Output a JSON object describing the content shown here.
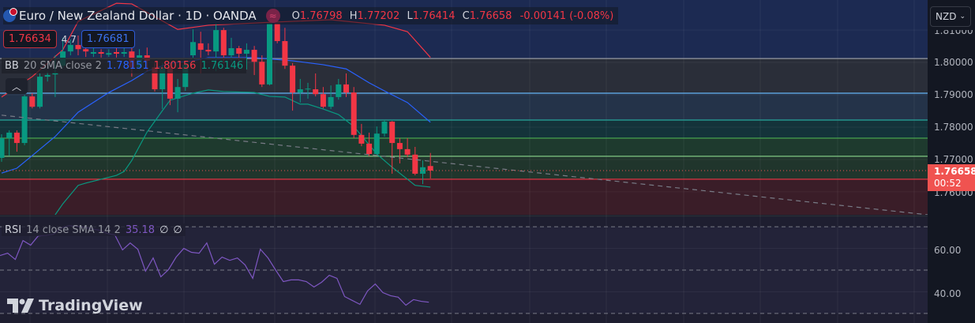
{
  "header": {
    "symbol": "Euro / New Zealand Dollar · 1D · OANDA",
    "o_label": "O",
    "o": "1.76798",
    "h_label": "H",
    "h": "1.77202",
    "l_label": "L",
    "l": "1.76414",
    "c_label": "C",
    "c": "1.76658",
    "change": "-0.00141 (-0.08%)",
    "flag_icon": "eu-nz-flag-icon",
    "badge_icon": "data-stream-icon"
  },
  "quote": {
    "bid": "1.76634",
    "spread": "4.7",
    "ask": "1.76681"
  },
  "bb_legend": {
    "name": "BB",
    "params": "20 SMA close 2",
    "basis": "1.78151",
    "upper": "1.80156",
    "lower": "1.76146"
  },
  "rsi_legend": {
    "name": "RSI",
    "params": "14 close SMA 14 2",
    "value": "35.18",
    "na1": "∅",
    "na2": "∅"
  },
  "price_axis": {
    "currency": "NZD",
    "ticks": [
      "1.81000",
      "1.80000",
      "1.79000",
      "1.78000",
      "1.77000",
      "1.76000"
    ],
    "last_price": "1.76658",
    "countdown": "00:52"
  },
  "rsi_axis": {
    "ticks": [
      "60.00",
      "40.00"
    ]
  },
  "branding": "TradingView",
  "colors": {
    "up": "#089981",
    "down": "#f23645",
    "bb_basis": "#2962ff",
    "bb_upper": "#f23645",
    "bb_lower": "#089981",
    "rsi": "#7e57c2"
  },
  "chart_data": {
    "type": "candlestick",
    "ylim": [
      1.7529,
      1.8193
    ],
    "rsi_ylim": [
      25.6,
      74.4
    ],
    "candles": [
      [
        1.7705,
        1.7778,
        1.7693,
        1.7766
      ],
      [
        1.7766,
        1.779,
        1.7712,
        1.7783
      ],
      [
        1.7783,
        1.779,
        1.7724,
        1.7751
      ],
      [
        1.7751,
        1.79,
        1.7744,
        1.7895
      ],
      [
        1.7895,
        1.7905,
        1.7858,
        1.7863
      ],
      [
        1.7863,
        1.7966,
        1.7858,
        1.7956
      ],
      [
        1.7956,
        1.7971,
        1.7941,
        1.7961
      ],
      [
        1.7963,
        1.8022,
        1.7893,
        1.7968
      ],
      [
        1.799,
        1.8076,
        1.7983,
        1.8034
      ],
      [
        1.8034,
        1.8071,
        1.8022,
        1.8054
      ],
      [
        1.8054,
        1.8083,
        1.8022,
        1.8041
      ],
      [
        1.8041,
        1.8059,
        1.8017,
        1.8034
      ],
      [
        1.8027,
        1.8046,
        1.8017,
        1.8032
      ],
      [
        1.8032,
        1.8041,
        1.8015,
        1.8027
      ],
      [
        1.8024,
        1.8041,
        1.8017,
        1.8029
      ],
      [
        1.8032,
        1.8046,
        1.8015,
        1.8027
      ],
      [
        1.8027,
        1.8046,
        1.8017,
        1.8032
      ],
      [
        1.8034,
        1.8046,
        1.7956,
        1.7985
      ],
      [
        1.7985,
        1.8041,
        1.7978,
        1.8022
      ],
      [
        1.8022,
        1.8046,
        1.7973,
        1.8005
      ],
      [
        1.7985,
        1.7998,
        1.791,
        1.7917
      ],
      [
        1.7917,
        1.7998,
        1.7856,
        1.7985
      ],
      [
        1.7985,
        1.7998,
        1.7868,
        1.7888
      ],
      [
        1.7888,
        1.7949,
        1.7846,
        1.7924
      ],
      [
        1.7924,
        1.8002,
        1.7912,
        1.7993
      ],
      [
        1.8022,
        1.8102,
        1.801,
        1.8063
      ],
      [
        1.8059,
        1.8095,
        1.7966,
        1.8039
      ],
      [
        1.8039,
        1.8059,
        1.8022,
        1.8034
      ],
      [
        1.8034,
        1.812,
        1.7973,
        1.81
      ],
      [
        1.81,
        1.8107,
        1.7998,
        1.8022
      ],
      [
        1.8022,
        1.8076,
        1.8002,
        1.8044
      ],
      [
        1.8044,
        1.8051,
        1.799,
        1.8027
      ],
      [
        1.8027,
        1.8059,
        1.7978,
        1.8039
      ],
      [
        1.8039,
        1.8051,
        1.7961,
        1.8002
      ],
      [
        1.8002,
        1.8022,
        1.7924,
        1.7932
      ],
      [
        1.7932,
        1.812,
        1.7929,
        1.812
      ],
      [
        1.812,
        1.812,
        1.8059,
        1.8066
      ],
      [
        1.8066,
        1.8107,
        1.798,
        1.799
      ],
      [
        1.799,
        1.7998,
        1.7851,
        1.7907
      ],
      [
        1.7907,
        1.7949,
        1.7876,
        1.7917
      ],
      [
        1.7917,
        1.7937,
        1.7888,
        1.7919
      ],
      [
        1.7917,
        1.7966,
        1.7895,
        1.7902
      ],
      [
        1.7902,
        1.7924,
        1.7858,
        1.7863
      ],
      [
        1.7863,
        1.7929,
        1.7856,
        1.7893
      ],
      [
        1.7893,
        1.7949,
        1.7885,
        1.7932
      ],
      [
        1.7932,
        1.7966,
        1.7893,
        1.7907
      ],
      [
        1.7907,
        1.7924,
        1.7766,
        1.7776
      ],
      [
        1.7776,
        1.781,
        1.7741,
        1.7749
      ],
      [
        1.7749,
        1.7783,
        1.771,
        1.7717
      ],
      [
        1.7717,
        1.7802,
        1.7715,
        1.778
      ],
      [
        1.778,
        1.7822,
        1.7771,
        1.7817
      ],
      [
        1.7817,
        1.7819,
        1.7656,
        1.7751
      ],
      [
        1.7751,
        1.7766,
        1.7688,
        1.7732
      ],
      [
        1.7732,
        1.7766,
        1.7707,
        1.7715
      ],
      [
        1.7715,
        1.7739,
        1.7651,
        1.7656
      ],
      [
        1.7656,
        1.7697,
        1.7624,
        1.7676
      ],
      [
        1.76798,
        1.77202,
        1.76414,
        1.76658
      ]
    ],
    "bb_upper": [
      [
        0,
        1.7893
      ],
      [
        4,
        1.7956
      ],
      [
        8,
        1.8039
      ],
      [
        10,
        1.8127
      ],
      [
        15,
        1.8183
      ],
      [
        17,
        1.8181
      ],
      [
        23,
        1.8102
      ],
      [
        27,
        1.8115
      ],
      [
        35,
        1.8124
      ],
      [
        43,
        1.8132
      ],
      [
        50,
        1.8115
      ],
      [
        53,
        1.8095
      ],
      [
        56,
        1.80156
      ]
    ],
    "bb_basis": [
      [
        0,
        1.7658
      ],
      [
        2,
        1.7673
      ],
      [
        4,
        1.7712
      ],
      [
        7,
        1.7771
      ],
      [
        10,
        1.7846
      ],
      [
        14,
        1.7907
      ],
      [
        17,
        1.7944
      ],
      [
        19,
        1.7973
      ],
      [
        22,
        1.7998
      ],
      [
        25,
        1.8005
      ],
      [
        27,
        1.8015
      ],
      [
        33,
        1.8015
      ],
      [
        38,
        1.8005
      ],
      [
        42,
        1.7993
      ],
      [
        45,
        1.798
      ],
      [
        48,
        1.7937
      ],
      [
        50,
        1.7912
      ],
      [
        53,
        1.7876
      ],
      [
        56,
        1.78151
      ]
    ],
    "bb_lower": [
      [
        7,
        1.7529
      ],
      [
        8,
        1.7563
      ],
      [
        10,
        1.762
      ],
      [
        11,
        1.7627
      ],
      [
        13,
        1.7639
      ],
      [
        15,
        1.7651
      ],
      [
        16,
        1.7663
      ],
      [
        17,
        1.7697
      ],
      [
        19,
        1.7785
      ],
      [
        21,
        1.7851
      ],
      [
        22,
        1.7883
      ],
      [
        25,
        1.7905
      ],
      [
        27,
        1.7915
      ],
      [
        29,
        1.791
      ],
      [
        33,
        1.7907
      ],
      [
        35,
        1.7895
      ],
      [
        37,
        1.7893
      ],
      [
        39,
        1.7871
      ],
      [
        40,
        1.7871
      ],
      [
        42,
        1.7856
      ],
      [
        44,
        1.7839
      ],
      [
        46,
        1.7802
      ],
      [
        49,
        1.7717
      ],
      [
        51,
        1.7676
      ],
      [
        53,
        1.7639
      ],
      [
        54,
        1.762
      ],
      [
        56,
        1.76146
      ]
    ],
    "levels": [
      {
        "price": 1.8012,
        "color": "#9598a1",
        "fill_above": "#1c2a52"
      },
      {
        "price": 1.7905,
        "color": "#64b5f6",
        "fill_above": "#2a2e39"
      },
      {
        "price": 1.7822,
        "color": "#26a69a",
        "fill_above": "#243349"
      },
      {
        "price": 1.7766,
        "color": "#4caf50",
        "fill_above": "#14333a"
      },
      {
        "price": 1.771,
        "color": "#81c784",
        "fill_above": "#1e3a2e"
      },
      {
        "price": 1.7639,
        "color": "#f23645",
        "fill_above": "#20352c",
        "fill_below": "#3a1d28"
      }
    ],
    "trendline": [
      [
        0,
        1.7837
      ],
      [
        121,
        1.7529
      ]
    ],
    "last_price": 1.76658,
    "rsi": [
      56.7,
      57.8,
      54.9,
      63.6,
      61.5,
      65.8,
      66.0,
      66.5,
      69.5,
      70.5,
      70.2,
      69.8,
      69.0,
      68.4,
      66.9,
      66.2,
      59.3,
      62.5,
      59.6,
      49.5,
      55.6,
      46.9,
      50.2,
      56.0,
      60.0,
      58.2,
      57.8,
      62.5,
      52.7,
      56.0,
      54.5,
      55.6,
      52.4,
      46.2,
      59.6,
      55.6,
      50.0,
      44.7,
      45.5,
      45.5,
      44.7,
      42.2,
      44.4,
      47.6,
      46.2,
      37.8,
      36.0,
      34.2,
      40.4,
      43.6,
      39.6,
      38.2,
      37.5,
      33.8,
      36.4,
      35.6,
      35.18
    ],
    "rsi_levels": [
      70,
      50,
      30
    ]
  }
}
